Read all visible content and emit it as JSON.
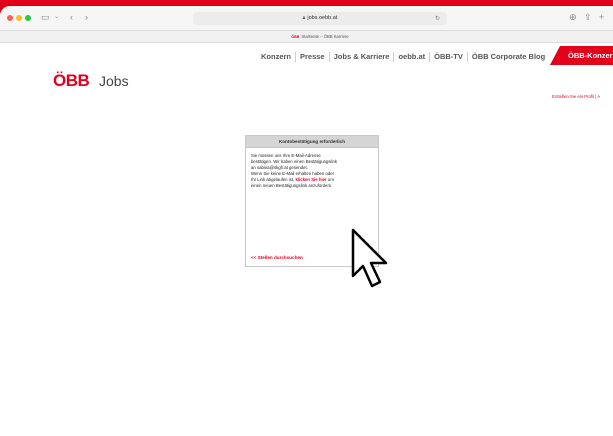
{
  "browser": {
    "url": "jobs.oebb.at",
    "tab_title": "Startseite – ÖBB Karriere",
    "favicon_label": "ÖBB"
  },
  "nav": {
    "items": [
      "Konzern",
      "Presse",
      "Jobs & Karriere",
      "oebb.at",
      "ÖBB-TV",
      "ÖBB Corporate Blog"
    ],
    "konzern_tab": "ÖBB-Konzern"
  },
  "header": {
    "logo": "ÖBB",
    "jobs_label": "Jobs",
    "profile_link": "Erstellen Sie ein Profil | A"
  },
  "dialog": {
    "title": "Kontobestätigung erforderlich",
    "line1": "Sie müssen uns Ihre E-Mail-Adresse",
    "line2": "bestätigen. Wir haben einen Bestätigungslink",
    "line3": "an sabina@skgh.at gesendet.",
    "line4": "Wenn Sie keine E-Mail erhalten haben oder",
    "line5_pre": "Ihr Link abgelaufen ist, ",
    "line5_link": "klicken Sie hier",
    "line5_post": " um",
    "line6": "einen neuen Bestätigungslink anzufordern.",
    "back_link": "<< Stellen durchsuchen"
  },
  "colors": {
    "brand": "#e2001a",
    "card_header": "#d5d5d5"
  }
}
